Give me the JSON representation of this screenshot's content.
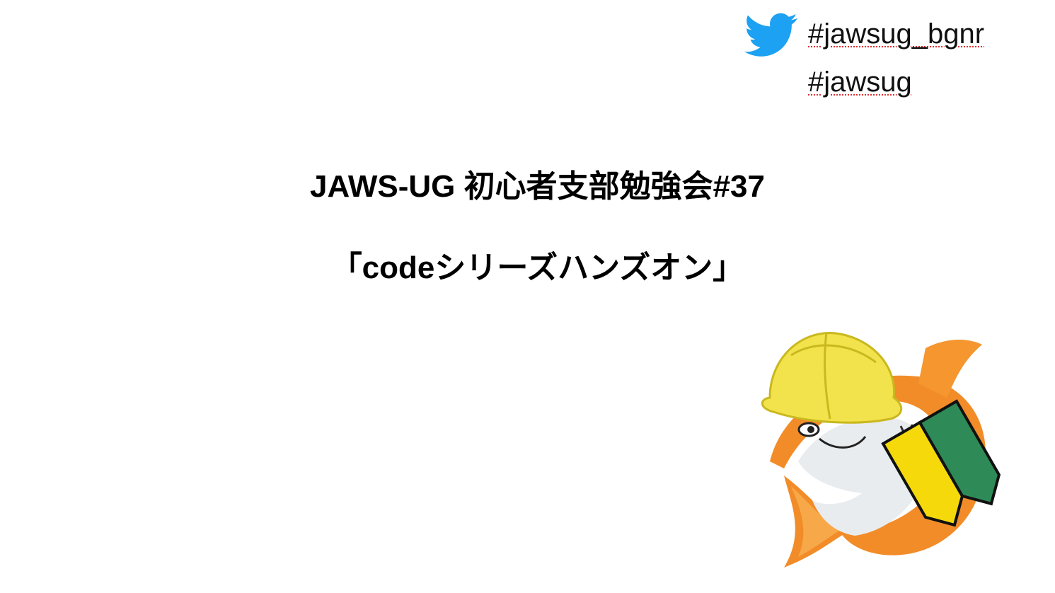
{
  "slide": {
    "hashtags": [
      "#jawsug_bgnr",
      "#jawsug"
    ],
    "title_line1": "JAWS-UG 初心者支部勉強会#37",
    "title_line2": "「codeシリーズハンズオン」"
  },
  "icons": {
    "twitter": "twitter-bird-icon",
    "mascot": "jaws-shark-beginner-mascot"
  },
  "colors": {
    "twitter_blue": "#1DA1F2",
    "shark_orange": "#F28C28",
    "hat_yellow": "#F2E34C",
    "beginner_green": "#2E8B57",
    "beginner_yellow": "#F5D90A"
  }
}
